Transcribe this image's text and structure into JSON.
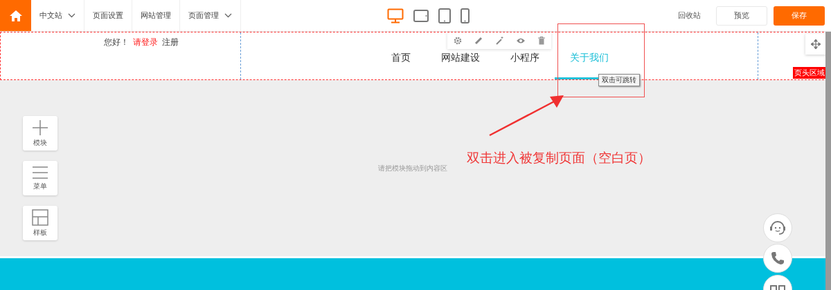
{
  "topbar": {
    "menu": [
      {
        "label": "中文站",
        "dropdown": true
      },
      {
        "label": "页面设置",
        "dropdown": false
      },
      {
        "label": "网站管理",
        "dropdown": false
      },
      {
        "label": "页面管理",
        "dropdown": true
      }
    ],
    "devices": [
      {
        "kind": "desktop",
        "selected": true
      },
      {
        "kind": "tablet-landscape",
        "selected": false
      },
      {
        "kind": "tablet",
        "selected": false
      },
      {
        "kind": "phone",
        "selected": false
      }
    ],
    "recycle": "回收站",
    "preview": "预览",
    "save": "保存"
  },
  "header": {
    "greeting": "您好！",
    "login": "请登录",
    "register": "注册",
    "nav": [
      {
        "label": "首页",
        "selected": false
      },
      {
        "label": "网站建设",
        "selected": false
      },
      {
        "label": "小程序",
        "selected": false
      },
      {
        "label": "关于我们",
        "selected": true
      }
    ],
    "region_label": "页头区域",
    "tooltip": "双击可跳转"
  },
  "tools": [
    {
      "kind": "plus",
      "label": "模块"
    },
    {
      "kind": "menu",
      "label": "菜单"
    },
    {
      "kind": "layout",
      "label": "样板"
    }
  ],
  "content_hint": "请把模块拖动到内容区",
  "annotation": "双击进入被复制页面（空白页）"
}
